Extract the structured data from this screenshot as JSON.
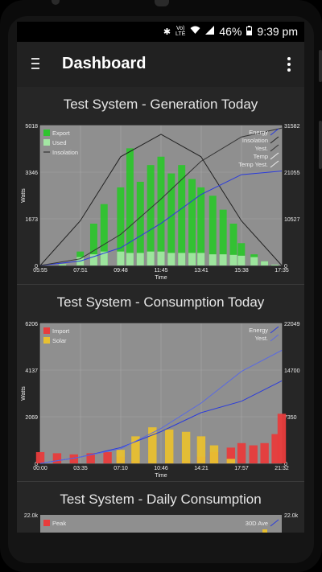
{
  "status_bar": {
    "time": "9:39 pm",
    "battery": "46%",
    "network": "LTE",
    "volte": "Vo)"
  },
  "app_bar": {
    "title": "Dashboard"
  },
  "cards": [
    {
      "title": "Test System - Generation Today",
      "y_left_ticks": [
        "5018",
        "3346",
        "1673",
        "0"
      ],
      "y_right_ticks": [
        "31582",
        "21055",
        "10527",
        "0"
      ],
      "x_ticks": [
        "05:55",
        "07:51",
        "09:48",
        "11:45",
        "13:41",
        "15:38",
        "17:35"
      ],
      "y_label": "Watts",
      "x_label": "Time",
      "legend_left": [
        "Export",
        "Used",
        "Insolation"
      ],
      "legend_right": [
        "Energy",
        "Insolation",
        "Yest.",
        "Temp",
        "Temp Yest."
      ]
    },
    {
      "title": "Test System - Consumption Today",
      "y_left_ticks": [
        "6206",
        "4137",
        "2069",
        "0"
      ],
      "y_right_ticks": [
        "22049",
        "14700",
        "7350",
        "0"
      ],
      "x_ticks": [
        "00:00",
        "03:35",
        "07:10",
        "10:46",
        "14:21",
        "17:57",
        "21:32"
      ],
      "y_label": "Watts",
      "x_label": "Time",
      "legend_left": [
        "Import",
        "Solar"
      ],
      "legend_right": [
        "Energy",
        "Yest."
      ]
    },
    {
      "title": "Test System - Daily Consumption",
      "y_left_ticks": [
        "22.0k"
      ],
      "y_right_ticks": [
        "22.0k"
      ],
      "legend_left": [
        "Peak"
      ],
      "legend_right": [
        "30D Ave"
      ]
    }
  ],
  "chart_data": [
    {
      "type": "bar",
      "title": "Test System - Generation Today",
      "xlabel": "Time",
      "ylabel": "Watts",
      "x_range": [
        "05:55",
        "17:35"
      ],
      "ylim": [
        0,
        5018
      ],
      "y2lim": [
        0,
        31582
      ],
      "series": [
        {
          "name": "Export",
          "type": "bar",
          "color": "#2ec42e",
          "x": [
            "06:00",
            "07:00",
            "07:51",
            "08:30",
            "09:00",
            "09:48",
            "10:15",
            "10:45",
            "11:15",
            "11:45",
            "12:15",
            "12:45",
            "13:15",
            "13:41",
            "14:15",
            "14:45",
            "15:15",
            "15:38",
            "16:15",
            "16:45",
            "17:15"
          ],
          "values": [
            0,
            50,
            500,
            1500,
            2200,
            2800,
            4200,
            3000,
            3600,
            3900,
            3300,
            3600,
            3100,
            2800,
            2500,
            2000,
            1500,
            800,
            400,
            150,
            30
          ]
        },
        {
          "name": "Used",
          "type": "bar",
          "color": "#a3e6a3",
          "x": [
            "06:00",
            "07:00",
            "07:51",
            "08:30",
            "09:00",
            "09:48",
            "10:15",
            "10:45",
            "11:15",
            "11:45",
            "12:15",
            "12:45",
            "13:15",
            "13:41",
            "14:15",
            "14:45",
            "15:15",
            "15:38",
            "16:15",
            "16:45",
            "17:15"
          ],
          "values": [
            0,
            50,
            300,
            400,
            500,
            500,
            450,
            450,
            500,
            500,
            450,
            450,
            450,
            450,
            400,
            400,
            380,
            350,
            300,
            150,
            30
          ]
        },
        {
          "name": "Insolation",
          "type": "line",
          "color": "#222222",
          "x": [
            "05:55",
            "07:51",
            "09:48",
            "11:45",
            "13:41",
            "15:38",
            "17:35"
          ],
          "values": [
            0,
            1600,
            3900,
            4700,
            3900,
            1600,
            0
          ]
        },
        {
          "name": "Energy",
          "type": "line",
          "color": "#2a3bdc",
          "axis": "right",
          "x": [
            "05:55",
            "07:51",
            "09:48",
            "11:45",
            "13:41",
            "15:38",
            "17:35"
          ],
          "values": [
            0,
            1000,
            4000,
            9500,
            16000,
            20500,
            21300
          ]
        },
        {
          "name": "Yest.",
          "type": "line",
          "color": "#333333",
          "axis": "right",
          "x": [
            "05:55",
            "07:51",
            "09:48",
            "11:45",
            "13:41",
            "15:38",
            "17:35"
          ],
          "values": [
            0,
            1500,
            7000,
            15000,
            23500,
            29000,
            31000
          ]
        }
      ]
    },
    {
      "type": "bar",
      "title": "Test System - Consumption Today",
      "xlabel": "Time",
      "ylabel": "Watts",
      "x_range": [
        "00:00",
        "21:32"
      ],
      "ylim": [
        0,
        6206
      ],
      "y2lim": [
        0,
        22049
      ],
      "series": [
        {
          "name": "Import",
          "type": "bar",
          "color": "#e83c3c",
          "x": [
            "00:00",
            "01:30",
            "03:00",
            "04:30",
            "06:00",
            "07:10",
            "08:30",
            "10:00",
            "11:30",
            "13:00",
            "14:21",
            "15:30",
            "17:00",
            "17:57",
            "19:00",
            "20:00",
            "21:00",
            "21:32"
          ],
          "values": [
            500,
            450,
            400,
            450,
            500,
            300,
            100,
            50,
            50,
            100,
            300,
            500,
            700,
            900,
            800,
            900,
            1300,
            2200
          ]
        },
        {
          "name": "Solar",
          "type": "bar",
          "color": "#e8c030",
          "x": [
            "00:00",
            "01:30",
            "03:00",
            "04:30",
            "06:00",
            "07:10",
            "08:30",
            "10:00",
            "11:30",
            "13:00",
            "14:21",
            "15:30",
            "17:00",
            "17:57",
            "19:00",
            "20:00",
            "21:00",
            "21:32"
          ],
          "values": [
            0,
            0,
            0,
            0,
            0,
            600,
            1200,
            1600,
            1500,
            1400,
            1200,
            800,
            200,
            0,
            0,
            0,
            0,
            0
          ]
        },
        {
          "name": "Energy",
          "type": "line",
          "color": "#2a3bdc",
          "axis": "right",
          "x": [
            "00:00",
            "03:35",
            "07:10",
            "10:46",
            "14:21",
            "17:57",
            "21:32"
          ],
          "values": [
            0,
            1000,
            2500,
            5000,
            8000,
            9800,
            13000
          ]
        },
        {
          "name": "Yest.",
          "type": "line",
          "color": "#5a6ae0",
          "axis": "right",
          "x": [
            "00:00",
            "03:35",
            "07:10",
            "10:46",
            "14:21",
            "17:57",
            "21:32"
          ],
          "values": [
            0,
            1000,
            2300,
            5500,
            9500,
            14500,
            17800
          ]
        }
      ]
    }
  ]
}
